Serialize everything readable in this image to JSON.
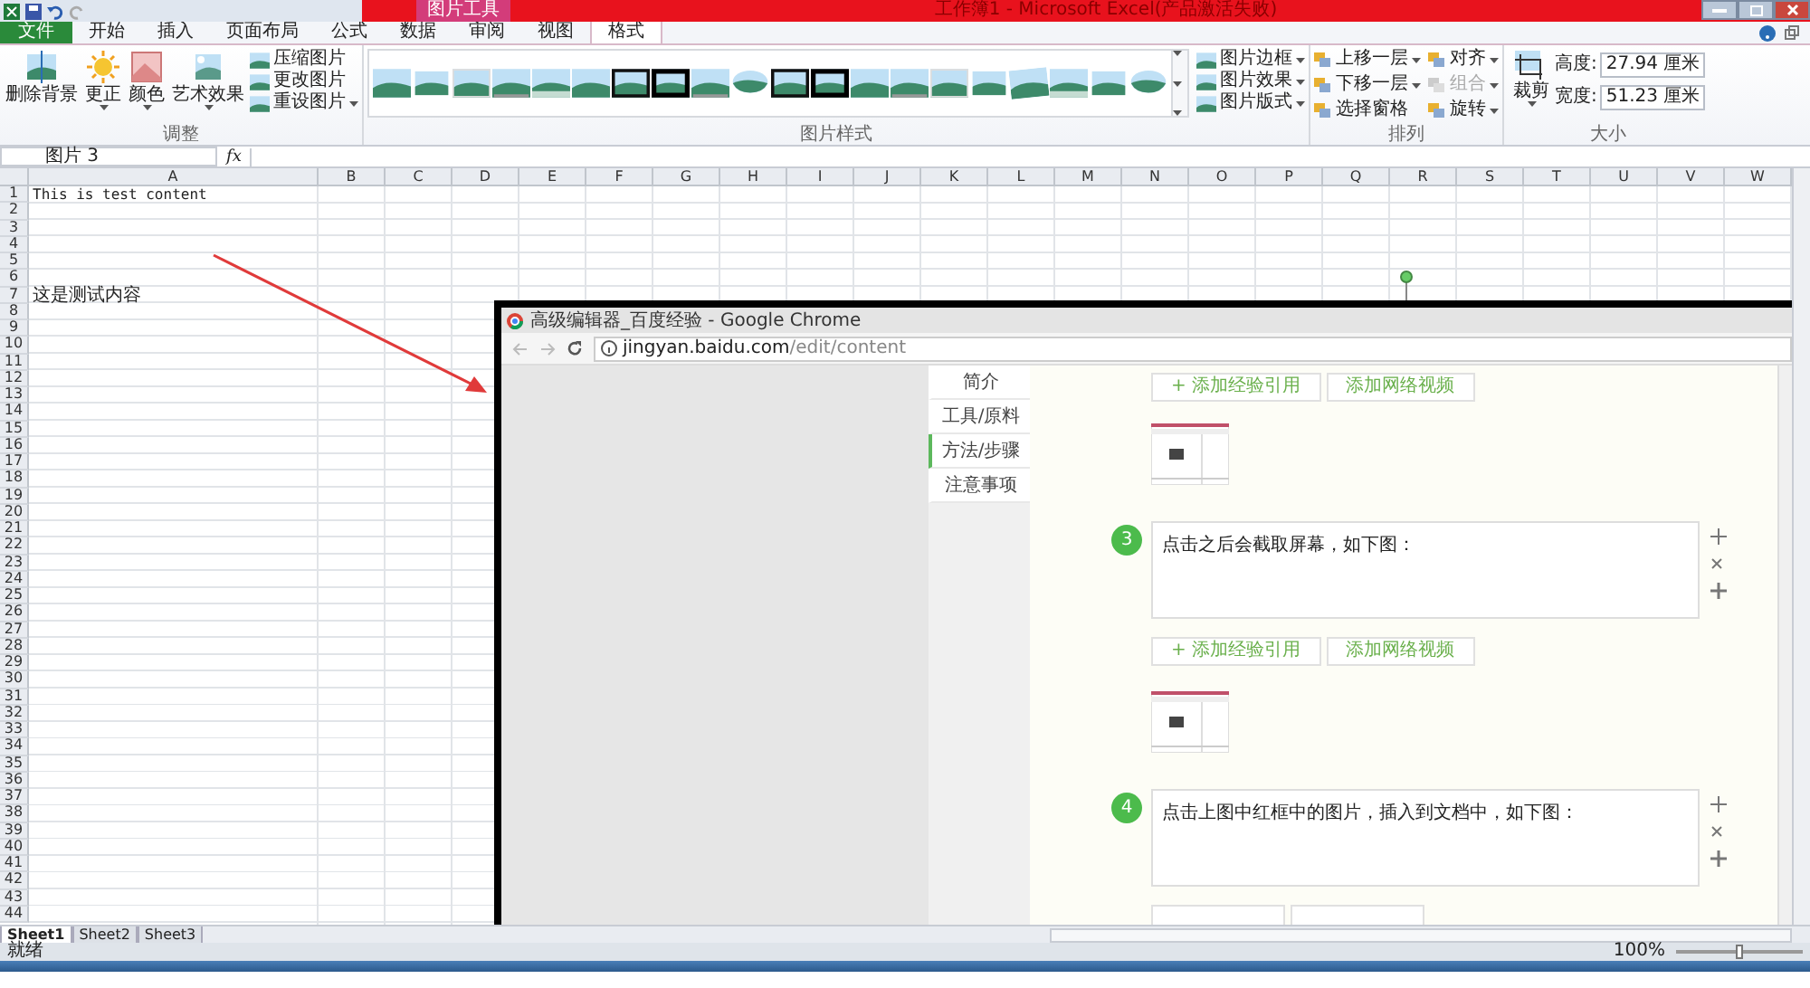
{
  "window": {
    "title": "工作簿1 - Microsoft Excel(产品激活失败)",
    "context_tab": "图片工具"
  },
  "ribbon_tabs": [
    {
      "label": "文件",
      "kind": "file",
      "selected": false
    },
    {
      "label": "开始",
      "kind": "tab",
      "selected": false
    },
    {
      "label": "插入",
      "kind": "tab",
      "selected": false
    },
    {
      "label": "页面布局",
      "kind": "tab",
      "selected": false
    },
    {
      "label": "公式",
      "kind": "tab",
      "selected": false
    },
    {
      "label": "数据",
      "kind": "tab",
      "selected": false
    },
    {
      "label": "审阅",
      "kind": "tab",
      "selected": false
    },
    {
      "label": "视图",
      "kind": "tab",
      "selected": false
    },
    {
      "label": "格式",
      "kind": "context",
      "selected": true
    }
  ],
  "adjust_group": {
    "label": "调整",
    "large_buttons": [
      {
        "label": "删除背景",
        "dropdown": false,
        "kind": "remove-bg"
      },
      {
        "label": "更正",
        "dropdown": true,
        "kind": "sun"
      },
      {
        "label": "颜色",
        "dropdown": true,
        "kind": "palette"
      },
      {
        "label": "艺术效果",
        "dropdown": true,
        "kind": "art"
      }
    ],
    "small_buttons": [
      {
        "label": "压缩图片",
        "dropdown": false
      },
      {
        "label": "更改图片",
        "dropdown": false
      },
      {
        "label": "重设图片",
        "dropdown": true
      }
    ]
  },
  "styles_group": {
    "label": "图片样式",
    "styles": [
      {
        "kind": "plain"
      },
      {
        "kind": "white"
      },
      {
        "kind": "soft"
      },
      {
        "kind": "shadow"
      },
      {
        "kind": "fade"
      },
      {
        "kind": "plain"
      },
      {
        "kind": "black"
      },
      {
        "kind": "thick-black"
      },
      {
        "kind": "shadow"
      },
      {
        "kind": "oval"
      },
      {
        "kind": "black"
      },
      {
        "kind": "thick-black"
      },
      {
        "kind": "plain"
      },
      {
        "kind": "shadow"
      },
      {
        "kind": "soft"
      },
      {
        "kind": "white"
      },
      {
        "kind": "rotated"
      },
      {
        "kind": "fade"
      },
      {
        "kind": "white"
      },
      {
        "kind": "oval"
      }
    ],
    "commands": [
      {
        "label": "图片边框"
      },
      {
        "label": "图片效果"
      },
      {
        "label": "图片版式"
      }
    ]
  },
  "arrange_group": {
    "label": "排列",
    "commands": [
      {
        "label": "上移一层",
        "dropdown": true,
        "disabled": false
      },
      {
        "label": "对齐",
        "dropdown": true,
        "disabled": false
      },
      {
        "label": "下移一层",
        "dropdown": true,
        "disabled": false
      },
      {
        "label": "组合",
        "dropdown": true,
        "disabled": true
      },
      {
        "label": "选择窗格",
        "dropdown": false,
        "disabled": false
      },
      {
        "label": "旋转",
        "dropdown": true,
        "disabled": false
      }
    ]
  },
  "size_group": {
    "label": "大小",
    "crop_label": "裁剪",
    "fields": [
      {
        "label": "高度:",
        "value": "27.94 厘米"
      },
      {
        "label": "宽度:",
        "value": "51.23 厘米"
      }
    ]
  },
  "formula_bar": {
    "name_box": "图片 3",
    "fx": "fx"
  },
  "sheet": {
    "columns": [
      "A",
      "B",
      "C",
      "D",
      "E",
      "F",
      "G",
      "H",
      "I",
      "J",
      "K",
      "L",
      "M",
      "N",
      "O",
      "P",
      "Q",
      "R",
      "S",
      "T",
      "U",
      "V",
      "W"
    ],
    "rows": [
      {
        "label": "1",
        "column_a": "This is test content"
      },
      {
        "label": "2"
      },
      {
        "label": "3"
      },
      {
        "label": "4"
      },
      {
        "label": "5"
      },
      {
        "label": "6"
      },
      {
        "label": "7",
        "column_a": "这是测试内容"
      },
      {
        "label": "8"
      },
      {
        "label": "9"
      },
      {
        "label": "10"
      },
      {
        "label": "11"
      },
      {
        "label": "12"
      },
      {
        "label": "13"
      },
      {
        "label": "14"
      },
      {
        "label": "15"
      },
      {
        "label": "16"
      },
      {
        "label": "17"
      },
      {
        "label": "18"
      },
      {
        "label": "19"
      },
      {
        "label": "20"
      },
      {
        "label": "21"
      },
      {
        "label": "22"
      },
      {
        "label": "23"
      },
      {
        "label": "24"
      },
      {
        "label": "25"
      },
      {
        "label": "26"
      },
      {
        "label": "27"
      },
      {
        "label": "28"
      },
      {
        "label": "29"
      },
      {
        "label": "30"
      },
      {
        "label": "31"
      },
      {
        "label": "32"
      },
      {
        "label": "33"
      },
      {
        "label": "34"
      },
      {
        "label": "35"
      },
      {
        "label": "36"
      },
      {
        "label": "37"
      },
      {
        "label": "38"
      },
      {
        "label": "39"
      },
      {
        "label": "40"
      },
      {
        "label": "41"
      },
      {
        "label": "42"
      },
      {
        "label": "43"
      },
      {
        "label": "44"
      }
    ]
  },
  "embedded_screenshot": {
    "title": "高级编辑器_百度经验 - Google Chrome",
    "url_domain": "jingyan.baidu.com",
    "url_path": "/edit/content",
    "nav": [
      {
        "label": "简介",
        "selected": false
      },
      {
        "label": "工具/原料",
        "selected": false
      },
      {
        "label": "方法/步骤",
        "selected": true
      },
      {
        "label": "注意事项",
        "selected": false
      }
    ],
    "content": [
      {
        "kind": "buttons",
        "buttons": [
          "+ 添加经验引用",
          "添加网络视频"
        ]
      },
      {
        "kind": "thumbnail"
      },
      {
        "kind": "step",
        "number": "3",
        "text": "点击之后会截取屏幕，如下图："
      },
      {
        "kind": "buttons",
        "buttons": [
          "+ 添加经验引用",
          "添加网络视频"
        ]
      },
      {
        "kind": "thumbnail"
      },
      {
        "kind": "step",
        "number": "4",
        "text": "点击上图中红框中的图片，插入到文档中，如下图："
      },
      {
        "kind": "cut-buttons"
      }
    ]
  },
  "sheet_tabs": [
    {
      "label": "Sheet1",
      "selected": true
    },
    {
      "label": "Sheet2",
      "selected": false
    },
    {
      "label": "Sheet3",
      "selected": false
    }
  ],
  "status_bar": {
    "text": "就绪",
    "zoom": "100%",
    "zoom_level": {
      "level": 0.5
    }
  }
}
